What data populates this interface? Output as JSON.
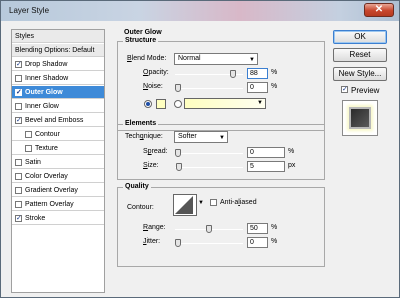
{
  "window": {
    "title": "Layer Style",
    "close_glyph": "✕"
  },
  "styles_list": {
    "items": [
      {
        "label": "Styles",
        "checkbox": false,
        "checked": false,
        "selected": false,
        "header": true,
        "indent": 0
      },
      {
        "label": "Blending Options: Default",
        "checkbox": false,
        "checked": false,
        "selected": false,
        "header": true,
        "indent": 0
      },
      {
        "label": "Drop Shadow",
        "checkbox": true,
        "checked": true,
        "selected": false,
        "indent": 0
      },
      {
        "label": "Inner Shadow",
        "checkbox": true,
        "checked": false,
        "selected": false,
        "indent": 0
      },
      {
        "label": "Outer Glow",
        "checkbox": true,
        "checked": true,
        "selected": true,
        "indent": 0
      },
      {
        "label": "Inner Glow",
        "checkbox": true,
        "checked": false,
        "selected": false,
        "indent": 0
      },
      {
        "label": "Bevel and Emboss",
        "checkbox": true,
        "checked": true,
        "selected": false,
        "indent": 0
      },
      {
        "label": "Contour",
        "checkbox": true,
        "checked": false,
        "selected": false,
        "indent": 1
      },
      {
        "label": "Texture",
        "checkbox": true,
        "checked": false,
        "selected": false,
        "indent": 1
      },
      {
        "label": "Satin",
        "checkbox": true,
        "checked": false,
        "selected": false,
        "indent": 0
      },
      {
        "label": "Color Overlay",
        "checkbox": true,
        "checked": false,
        "selected": false,
        "indent": 0
      },
      {
        "label": "Gradient Overlay",
        "checkbox": true,
        "checked": false,
        "selected": false,
        "indent": 0
      },
      {
        "label": "Pattern Overlay",
        "checkbox": true,
        "checked": false,
        "selected": false,
        "indent": 0
      },
      {
        "label": "Stroke",
        "checkbox": true,
        "checked": true,
        "selected": false,
        "indent": 0
      }
    ]
  },
  "outer_glow": {
    "title": "Outer Glow",
    "structure": {
      "title": "Structure",
      "blend_mode": {
        "label_u": "B",
        "label": "lend Mode:",
        "value": "Normal"
      },
      "opacity": {
        "label_u": "O",
        "label": "pacity:",
        "value": "88",
        "unit": "%",
        "level": 0.88
      },
      "noise": {
        "label_u": "N",
        "label": "oise:",
        "value": "0",
        "unit": "%",
        "level": 0
      },
      "glow_color": "#ffffc0"
    },
    "elements": {
      "title": "Elements",
      "technique": {
        "label_u": "q",
        "label_pre": "Tech",
        "label_post": "nique:",
        "value": "Softer"
      },
      "spread": {
        "label_u": "p",
        "label_pre": "S",
        "label_post": "read:",
        "value": "0",
        "unit": "%",
        "level": 0
      },
      "size": {
        "label_u": "S",
        "label": "ize:",
        "value": "5",
        "unit": "px",
        "level": 0.02
      }
    },
    "quality": {
      "title": "Quality",
      "contour_label": "Contour:",
      "anti_aliased": {
        "label_pre": "Anti-a",
        "label_u": "l",
        "label_post": "iased",
        "checked": false
      },
      "range": {
        "label_u": "R",
        "label": "ange:",
        "value": "50",
        "unit": "%",
        "level": 0.5
      },
      "jitter": {
        "label_u": "J",
        "label": "itter:",
        "value": "0",
        "unit": "%",
        "level": 0
      }
    }
  },
  "buttons": {
    "ok": "OK",
    "reset": "Reset",
    "new_style": "New Style...",
    "preview_label": "Preview",
    "preview_checked": true
  },
  "colors": {
    "selection": "#3e8ad8",
    "glow": "#ffffc0"
  }
}
